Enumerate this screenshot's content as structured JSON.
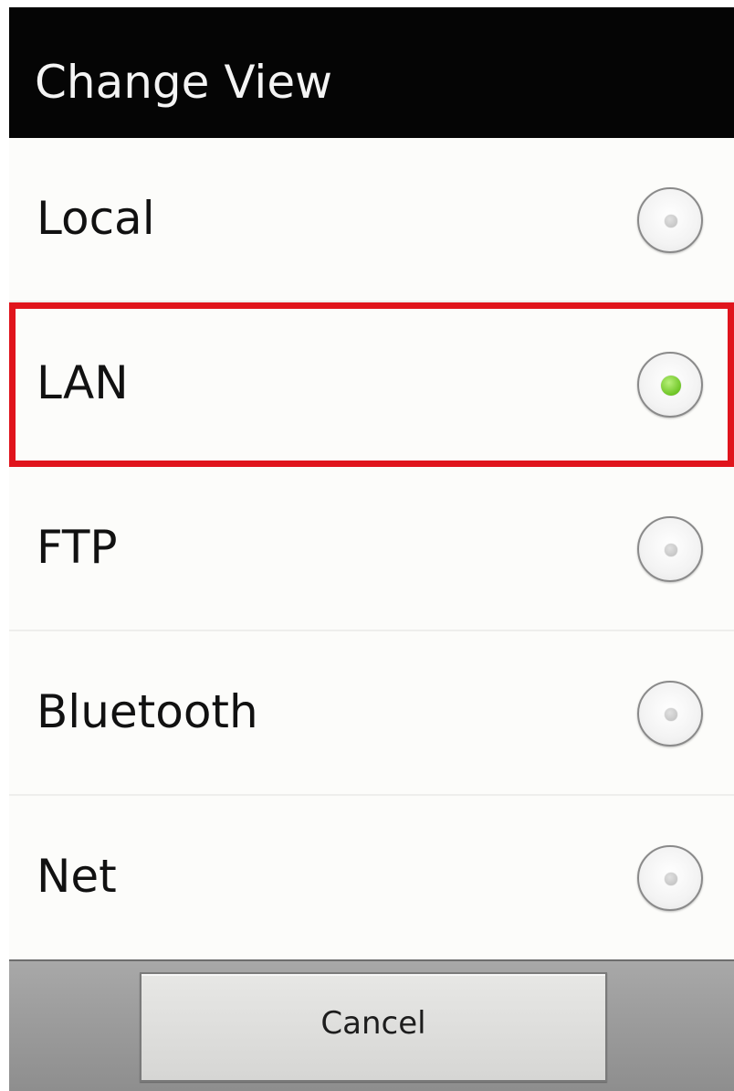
{
  "dialog": {
    "title": "Change View"
  },
  "options": [
    {
      "label": "Local",
      "selected": false
    },
    {
      "label": "LAN",
      "selected": true
    },
    {
      "label": "FTP",
      "selected": false
    },
    {
      "label": "Bluetooth",
      "selected": false
    },
    {
      "label": "Net",
      "selected": false
    }
  ],
  "buttons": {
    "cancel_label": "Cancel"
  },
  "colors": {
    "title_bar": "#050505",
    "highlight": "#e0141c",
    "selected_radio": "#6ec525"
  },
  "icons": {
    "radio_unselected": "radio-unselected-icon",
    "radio_selected": "radio-selected-icon"
  }
}
